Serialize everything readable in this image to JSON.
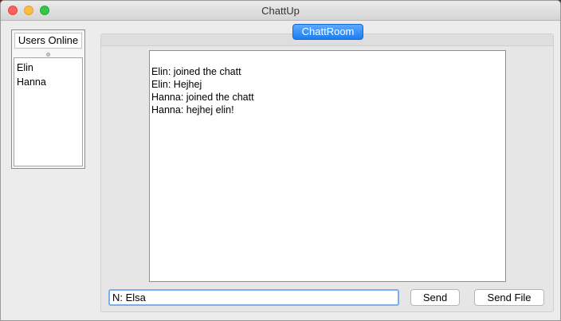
{
  "window": {
    "title": "ChattUp"
  },
  "users_panel": {
    "header": "Users Online",
    "users": [
      "Elin",
      "Hanna"
    ]
  },
  "chat": {
    "tab_label": "ChattRoom",
    "messages": [
      "Elin: joined the chatt",
      "Elin: Hejhej",
      "Hanna: joined the chatt",
      "Hanna: hejhej elin!"
    ],
    "input_value": "N: Elsa",
    "send_label": "Send",
    "send_file_label": "Send File"
  },
  "colors": {
    "tab_accent": "#1a7ff0",
    "input_focus_border": "#7aaef0"
  }
}
